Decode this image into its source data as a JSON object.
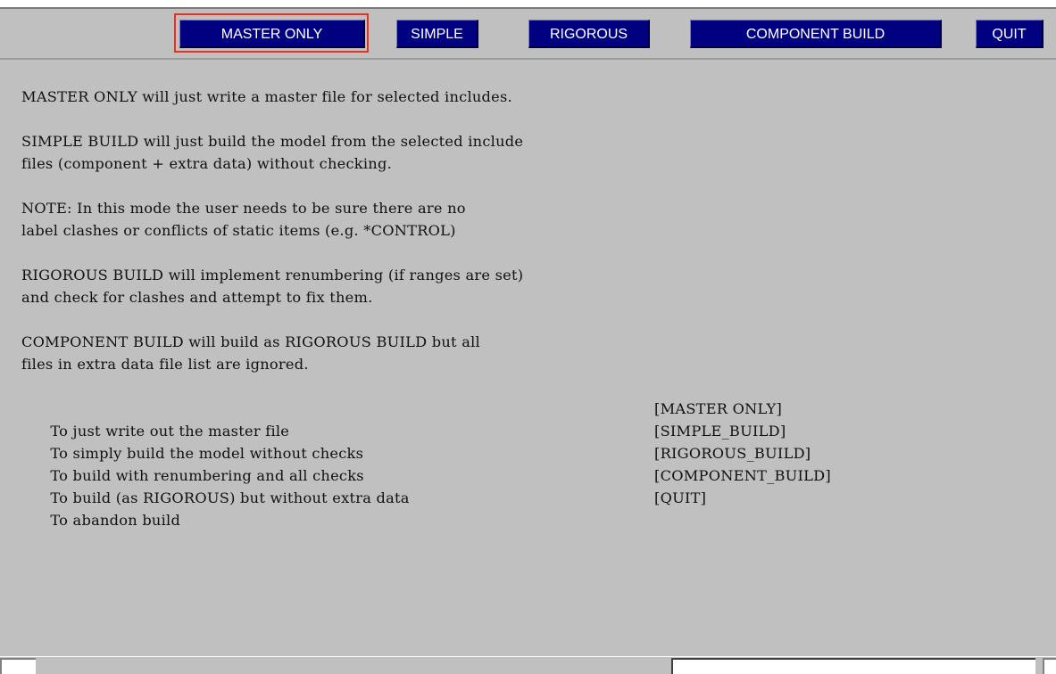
{
  "toolbar": {
    "master_only_label": "MASTER ONLY",
    "simple_label": "SIMPLE",
    "rigorous_label": "RIGOROUS",
    "component_build_label": "COMPONENT BUILD",
    "quit_label": "QUIT"
  },
  "help": {
    "lines": [
      "MASTER ONLY will just write a master file for selected includes.",
      "",
      "SIMPLE BUILD will just build the model from the selected include",
      "files (component + extra data) without checking.",
      "",
      "NOTE: In this mode the user needs to be sure there are no",
      "label clashes or conflicts of static items (e.g. *CONTROL)",
      "",
      "RIGOROUS BUILD will implement renumbering (if ranges are set)",
      "and check for clashes and attempt to fix them.",
      "",
      "COMPONENT BUILD will build as RIGOROUS BUILD but all",
      "files in extra data file list are ignored.",
      ""
    ],
    "options": [
      {
        "description": "To just write out the master file",
        "command": "[MASTER ONLY]"
      },
      {
        "description": "To simply build the model without checks",
        "command": "[SIMPLE_BUILD]"
      },
      {
        "description": "To build with renumbering and all checks",
        "command": "[RIGOROUS_BUILD]"
      },
      {
        "description": "To build (as RIGOROUS) but without extra data",
        "command": "[COMPONENT_BUILD]"
      },
      {
        "description": "To abandon build",
        "command": "[QUIT]"
      }
    ]
  },
  "colors": {
    "button_bg": "#000080",
    "panel_bg": "#c0c0c0",
    "focus_ring": "#e8321e"
  }
}
